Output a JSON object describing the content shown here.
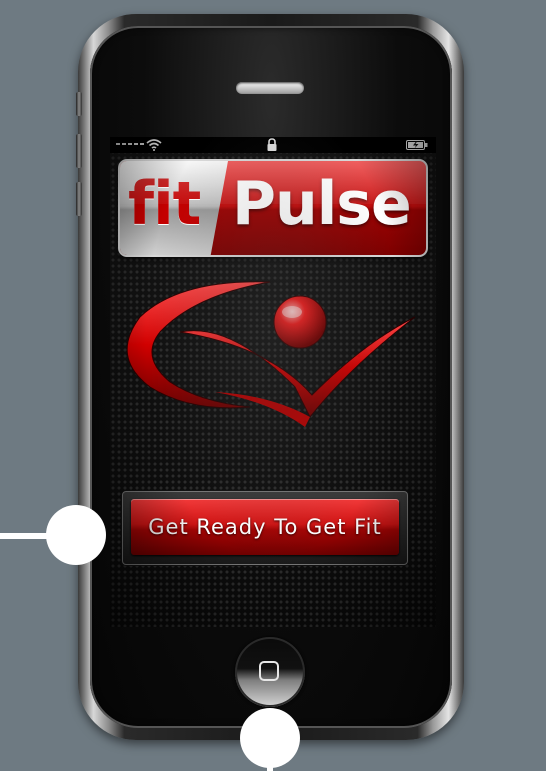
{
  "app": {
    "logo_part1": "fit",
    "logo_part2": "Pulse"
  },
  "statusbar": {
    "signal_icon": "signal-icon",
    "wifi_icon": "wifi-icon",
    "lock_icon": "lock-icon",
    "battery_icon": "battery-charging-icon"
  },
  "main": {
    "emblem_icon": "fitpulse-checkmark-emblem",
    "cta_label": "Get Ready To Get Fit"
  },
  "device": {
    "home_icon": "home-button-icon"
  },
  "colors": {
    "brand_red": "#c40000",
    "background": "#6e7a82",
    "callout": "#ffffff"
  }
}
